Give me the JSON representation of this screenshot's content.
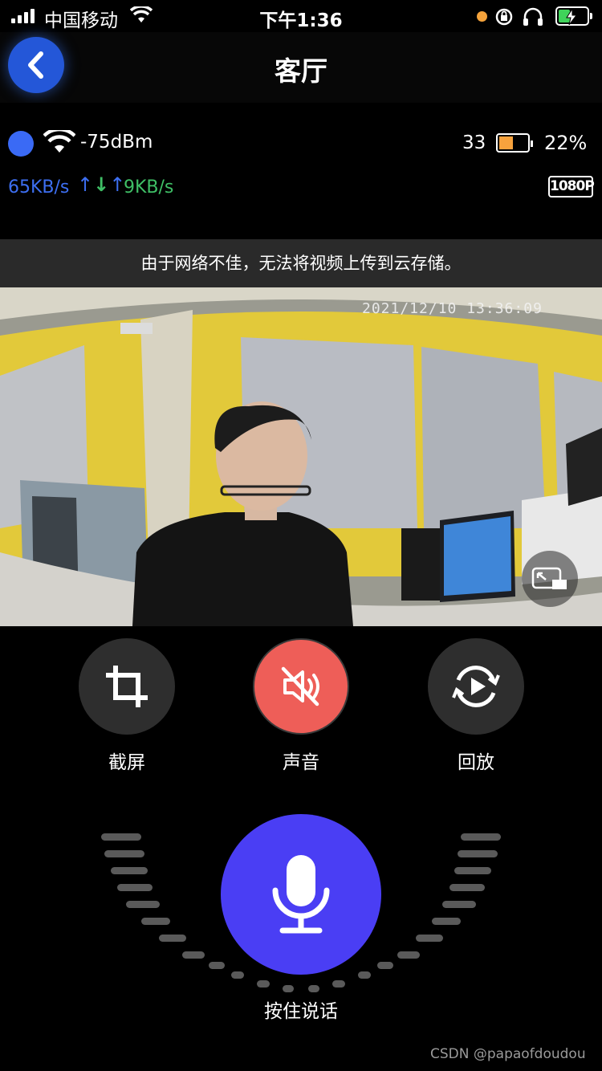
{
  "status_bar": {
    "carrier": "中国移动",
    "time": "下午1:36"
  },
  "nav": {
    "title": "客厅"
  },
  "device": {
    "signal": "-75dBm",
    "temperature": "33",
    "battery_percent": "22%",
    "battery_level": 0.22,
    "download_speed": "65KB/s",
    "upload_speed": "9KB/s",
    "resolution": "1080P"
  },
  "notice": "由于网络不佳，无法将视频上传到云存储。",
  "video": {
    "timestamp": "2021/12/10 13:36:09"
  },
  "controls": [
    {
      "label": "截屏",
      "icon": "crop-icon"
    },
    {
      "label": "声音",
      "icon": "speaker-muted-icon"
    },
    {
      "label": "回放",
      "icon": "replay-icon"
    }
  ],
  "talk": {
    "label": "按住说话",
    "icon": "microphone-icon"
  },
  "watermark": "CSDN @papaofdoudou",
  "colors": {
    "accent_blue": "#4a3ef4",
    "mute_red": "#ee5e58",
    "download_blue": "#3d6ff2",
    "upload_green": "#3fbf66",
    "battery_orange": "#f7a23d"
  }
}
